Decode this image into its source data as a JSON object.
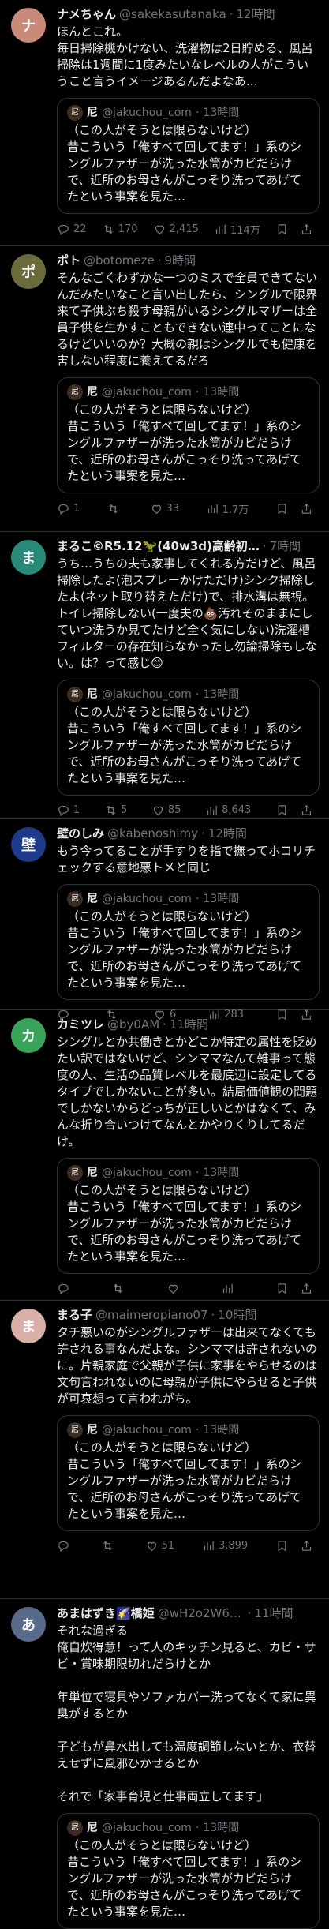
{
  "posts": [
    {
      "name": "ナメちゃん",
      "handle": "@sakekasutanaka",
      "time": "12時間",
      "body": "ほんとこれ。\n毎日掃除機かけない、洗濯物は2日貯める、風呂掃除は1週間に1度みたいなレベルの人がこういうこと言うイメージあるんだよなあ…",
      "avatar_color": "#c98a7a",
      "stats": {
        "replies": "22",
        "reposts": "170",
        "likes": "2,415",
        "views": "114万"
      }
    },
    {
      "name": "ポト",
      "handle": "@botomeze",
      "time": "9時間",
      "body": "そんなごくわずかな一つのミスで全員できてないんだみたいなこと言い出したら、シングルで限界来て子供ぶち殺す母親がいるシングルマザーは全員子供を生かすこともできない連中ってことになるけどいいのか？大概の親はシングルでも健康を害しない程度に養えてるだろ",
      "avatar_color": "#6b6a3a",
      "stats": {
        "replies": "1",
        "reposts": "",
        "likes": "33",
        "views": "1.7万"
      }
    },
    {
      "name": "まるこ©R5.12🦖(40w3d)高齢初…",
      "handle": "",
      "time": "7時間",
      "body": "うち…うちの夫も家事してくれる方だけど、風呂掃除したよ(泡スプレーかけただけ)シンク掃除したよ(ネット取り替えただけ)で、排水溝は無視。トイレ掃除しない(一度夫の💩汚れそのままにしていつ洗うか見てたけど全く気にしない)洗濯槽フィルターの存在知らなかったし勿論掃除もしない。は？って感じ😊",
      "avatar_color": "#2a8a7a",
      "stats": {
        "replies": "1",
        "reposts": "5",
        "likes": "85",
        "views": "8,643"
      }
    },
    {
      "name": "壁のしみ",
      "handle": "@kabenoshimy",
      "time": "12時間",
      "body": "もう今ってることが手すりを指で撫ってホコリチェックする意地悪トメと同じ",
      "avatar_color": "#1d3b8a",
      "stats": {
        "replies": "",
        "reposts": "",
        "likes": "6",
        "views": "283"
      }
    },
    {
      "name": "カミツレ",
      "handle": "@by0AM",
      "time": "11時間",
      "body": "シングルとか共働きとかどこか特定の属性を貶めたい訳ではないけど、シンママなんて雑事って態度の人、生活の品質レベルを最底辺に設定してるタイプでしかないことが多い。結局価値観の問題でしかないからどっちが正しいとかはなくて、みんな折り合いつけてなんとかやりくりしてるだけ。",
      "avatar_color": "#3aa35a",
      "stats": {
        "replies": "",
        "reposts": "",
        "likes": "",
        "views": ""
      }
    },
    {
      "name": "まる子",
      "handle": "@maimeropiano07",
      "time": "10時間",
      "body": "タチ悪いのがシングルファザーは出来てなくても許される事なんだよな。シンママは許されないのに。片親家庭で父親が子供に家事をやらせるのは文句言われないのに母親が子供にやらせると子供が可哀想って言われがち。",
      "avatar_color": "#d9b0a8",
      "stats": {
        "replies": "",
        "reposts": "",
        "likes": "51",
        "views": "3,899"
      }
    },
    {
      "name": "あまはずき🌠橋姫",
      "handle": "@wH2o2W6Vl…",
      "time": "11時間",
      "body": "それな過ぎる\n俺自炊得意！って人のキッチン見ると、カビ・サビ・賞味期限切れだらけとか\n\n年単位で寝具やソファカバー洗ってなくて家に異臭がするとか\n\n子どもが鼻水出しても温度調節しないとか、衣替えせずに風邪ひかせるとか\n\nそれで「家事育児と仕事両立してます」",
      "avatar_color": "#5a6a8a",
      "stats": {
        "replies": "",
        "reposts": "",
        "likes": "",
        "views": ""
      }
    }
  ],
  "quote": {
    "name": "尼",
    "handle": "@jakuchou_com",
    "time": "13時間",
    "body": "（この人がそうとは限らないけど）\n昔こういう「俺すべて回してます！」系のシングルファザーが洗った水筒がカビだらけで、近所のお母さんがこっそり洗ってあげてたという事案を見た…"
  }
}
